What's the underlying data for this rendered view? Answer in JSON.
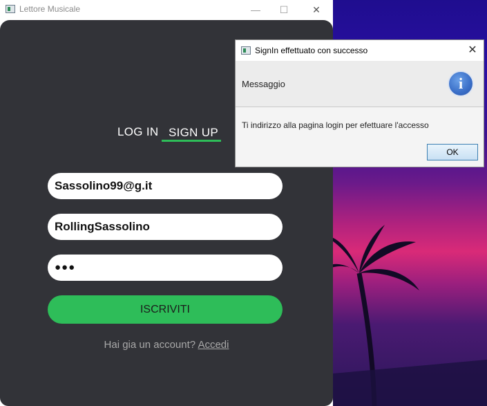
{
  "window": {
    "title": "Lettore Musicale",
    "minimize_symbol": "—",
    "maximize_symbol": "☐",
    "close_symbol": "✕"
  },
  "tabs": {
    "login_label": "LOG IN",
    "signup_label": "SIGN UP",
    "active": "SIGN UP"
  },
  "form": {
    "email_value": "Sassolino99@g.it",
    "username_value": "RollingSassolino",
    "password_value": "●●●",
    "submit_label": "ISCRIVITI"
  },
  "footer": {
    "question": "Hai gia un account?",
    "login_link": "Accedi"
  },
  "dialog": {
    "title": "SignIn effettuato con successo",
    "header": "Messaggio",
    "message": "Ti indirizzo alla pagina login per efettuare l'accesso",
    "ok_label": "OK",
    "close_symbol": "✕",
    "info_symbol": "i"
  },
  "colors": {
    "panel": "#323338",
    "accent": "#2ebd59",
    "dialog_bg": "#f4f4f4"
  }
}
